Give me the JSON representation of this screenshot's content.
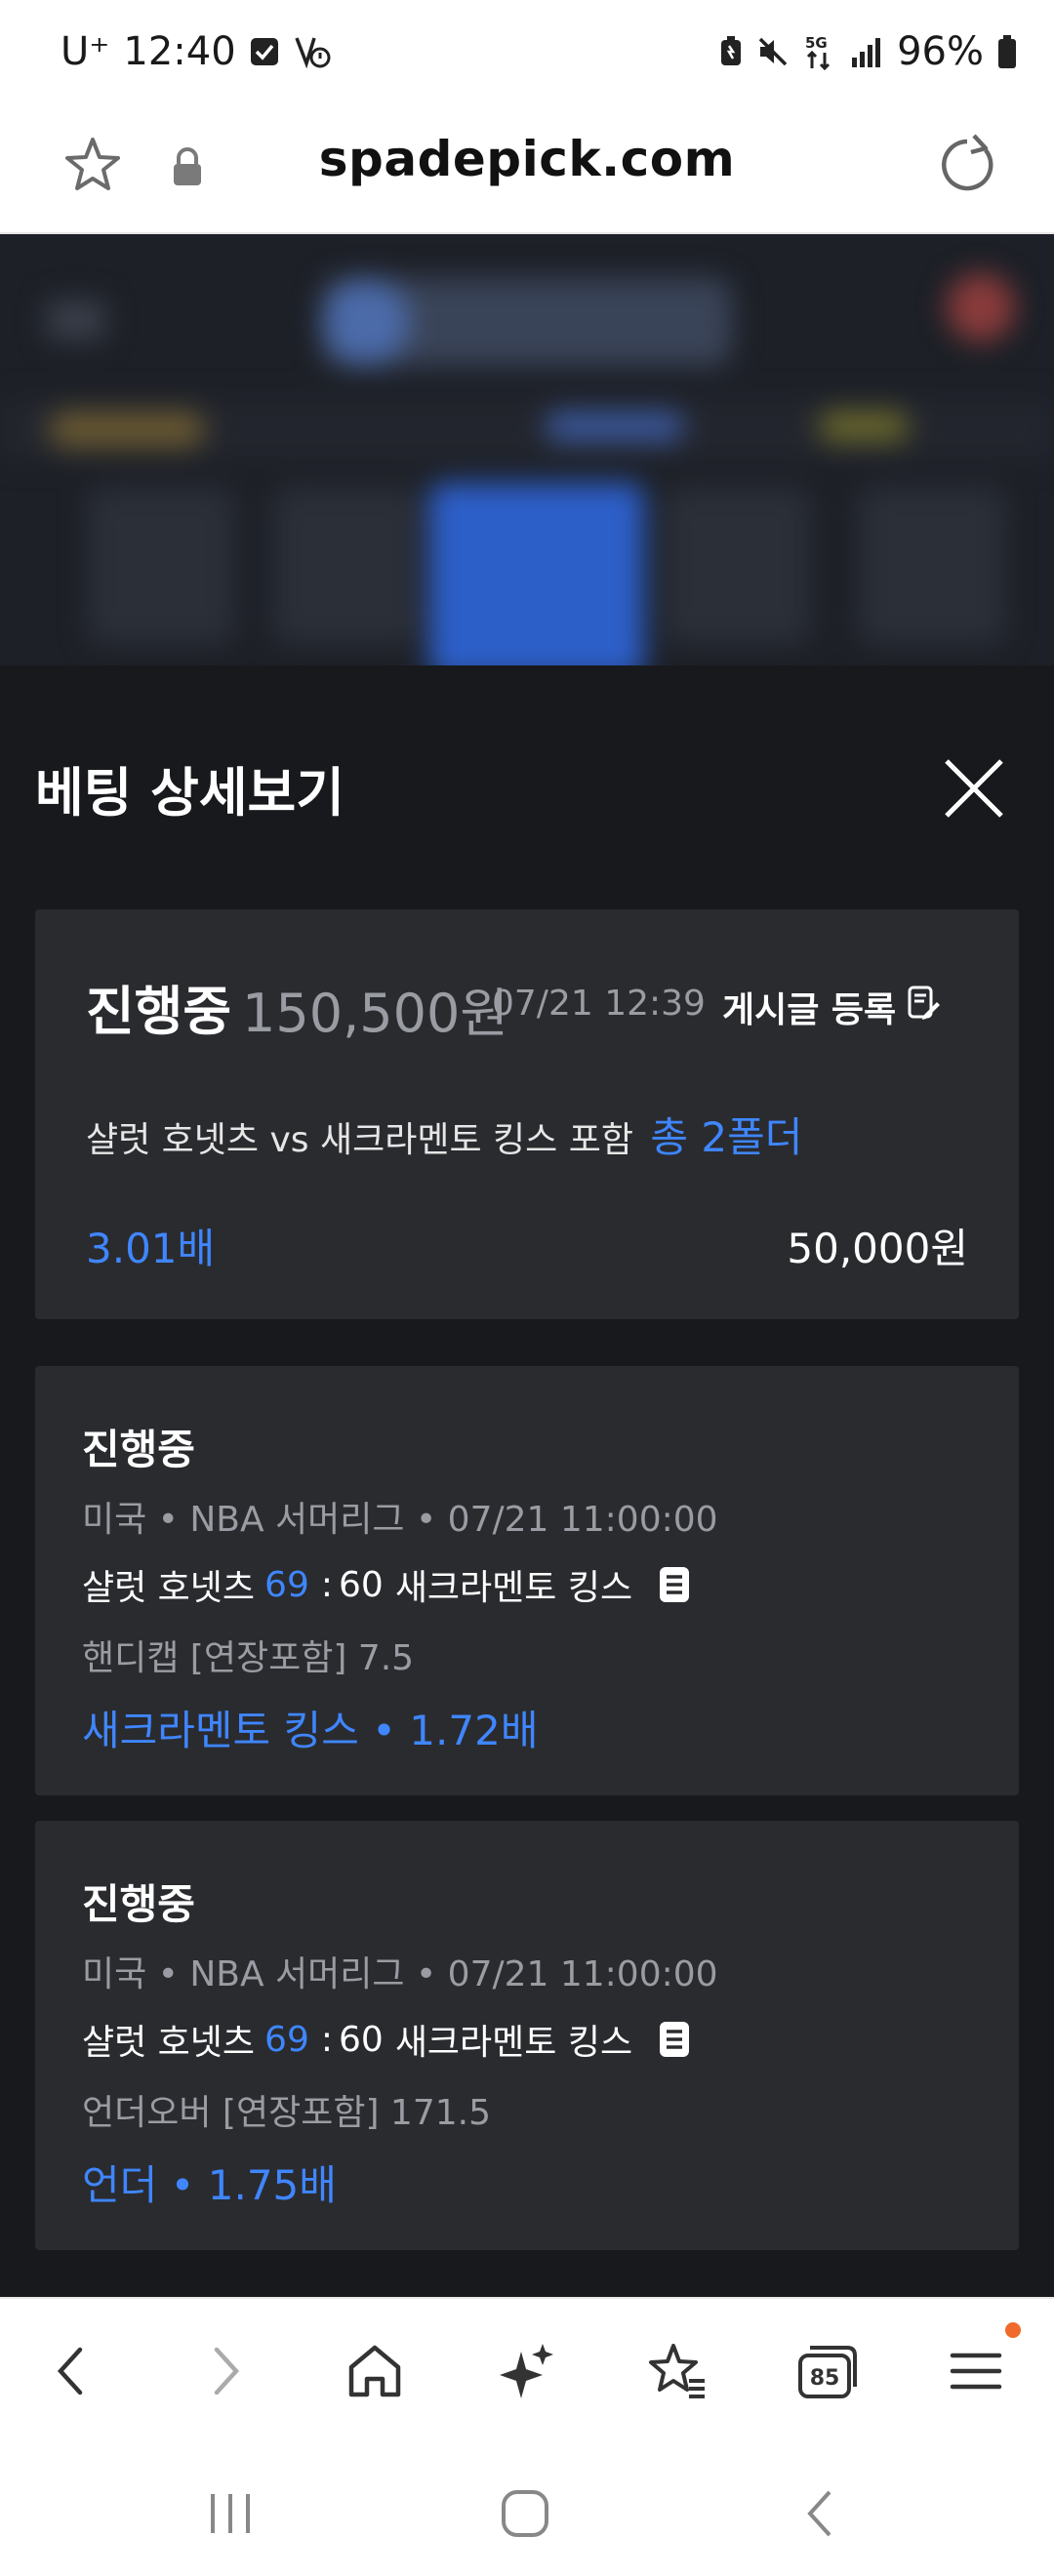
{
  "status_bar": {
    "carrier": "U⁺",
    "time": "12:40",
    "network": "5G",
    "battery": "96%"
  },
  "address_bar": {
    "url": "spadepick.com"
  },
  "sheet": {
    "title": "베팅 상세보기",
    "summary": {
      "status": "진행중",
      "amount": "150,500원",
      "datetime": "07/21 12:39",
      "post_button": "게시글 등록",
      "match_text": "샬럿 호넷츠 vs 새크라멘토 킹스 포함",
      "folder_count": "총 2폴더",
      "total_odds": "3.01배",
      "stake": "50,000원"
    },
    "bets": [
      {
        "status": "진행중",
        "league": "미국 • NBA 서머리그 • 07/21 11:00:00",
        "home": "샬럿 호넷츠",
        "home_score": "69",
        "colon": ":",
        "away_score": "60",
        "away": "새크라멘토 킹스",
        "market": "핸디캡 [연장포함] 7.5",
        "pick": "새크라멘토 킹스 • 1.72배"
      },
      {
        "status": "진행중",
        "league": "미국 • NBA 서머리그 • 07/21 11:00:00",
        "home": "샬럿 호넷츠",
        "home_score": "69",
        "colon": ":",
        "away_score": "60",
        "away": "새크라멘토 킹스",
        "market": "언더오버 [연장포함] 171.5",
        "pick": "언더 • 1.75배"
      }
    ]
  },
  "toolbar": {
    "tabs_count": "85"
  },
  "colors": {
    "accent_blue": "#3f86ff",
    "sheet_bg": "#18191c",
    "card_bg": "#2a2b2f",
    "notif_dot": "#f06a2b"
  },
  "icons": [
    "bookmark-star-icon",
    "lock-icon",
    "reload-icon",
    "close-icon",
    "memo-icon",
    "back-icon",
    "forward-icon",
    "home-icon",
    "ai-sparkle-icon",
    "bookmarks-icon",
    "tabs-icon",
    "menu-icon"
  ]
}
